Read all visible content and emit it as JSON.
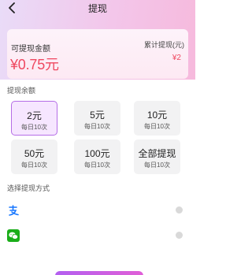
{
  "header": {
    "title": "提现"
  },
  "balance_card": {
    "available_label": "可提现金额",
    "available_amount": "¥0.75元",
    "total_label": "累计提现(元)",
    "total_amount": "¥2"
  },
  "amount_section": {
    "title": "提现余额",
    "options": [
      {
        "amount": "2元",
        "limit": "每日10次",
        "selected": true
      },
      {
        "amount": "5元",
        "limit": "每日10次",
        "selected": false
      },
      {
        "amount": "10元",
        "limit": "每日10次",
        "selected": false
      },
      {
        "amount": "50元",
        "limit": "每日10次",
        "selected": false
      },
      {
        "amount": "100元",
        "limit": "每日10次",
        "selected": false
      },
      {
        "amount": "全部提现",
        "limit": "每日10次",
        "selected": false
      }
    ]
  },
  "method_section": {
    "title": "选择提现方式",
    "methods": [
      {
        "icon": "alipay-icon",
        "color": "#1677ff"
      },
      {
        "icon": "wechat-pay-icon",
        "color": "#1aad19"
      }
    ]
  },
  "colors": {
    "accent": "#b56de6",
    "price": "#ef4860",
    "selected_bg": "#f6e6ff"
  }
}
